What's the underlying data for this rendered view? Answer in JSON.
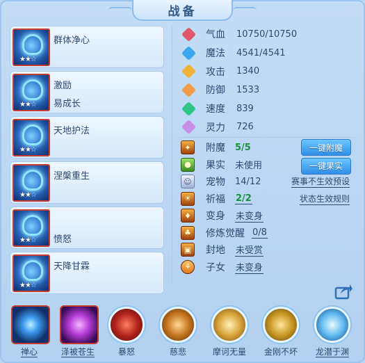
{
  "title": "战备",
  "skills": [
    {
      "name": "群体净心",
      "sub": "",
      "stars_on": 2,
      "stars_total": 3,
      "color": "#3c8ce0"
    },
    {
      "name": "激励",
      "sub": "易成长",
      "stars_on": 2,
      "stars_total": 3,
      "color": "#3c8ce0"
    },
    {
      "name": "天地护法",
      "sub": "",
      "stars_on": 2,
      "stars_total": 3,
      "color": "#2f73c8"
    },
    {
      "name": "涅槃重生",
      "sub": "",
      "stars_on": 2,
      "stars_total": 3,
      "color": "#3c8ce0"
    },
    {
      "name": "",
      "sub": "愤怒",
      "stars_on": 2,
      "stars_total": 3,
      "color": "#3fa0e6"
    },
    {
      "name": "天降甘霖",
      "sub": "",
      "stars_on": 2,
      "stars_total": 3,
      "color": "#3c8ce0"
    }
  ],
  "stats": [
    {
      "label": "气血",
      "value": "10750/10750",
      "icon": "heart-gem-icon",
      "color": "#e0566a"
    },
    {
      "label": "魔法",
      "value": "4541/4541",
      "icon": "mana-gem-icon",
      "color": "#3aa7f0"
    },
    {
      "label": "攻击",
      "value": "1340",
      "icon": "attack-gem-icon",
      "color": "#f2b437"
    },
    {
      "label": "防御",
      "value": "1533",
      "icon": "defense-gem-icon",
      "color": "#f29c4a"
    },
    {
      "label": "速度",
      "value": "839",
      "icon": "speed-gem-icon",
      "color": "#2fc586"
    },
    {
      "label": "灵力",
      "value": "726",
      "icon": "spirit-gem-icon",
      "color": "#c88ee8"
    }
  ],
  "extras": [
    {
      "label": "附魔",
      "value": "5/5",
      "style": "green",
      "icon": "enchant-icon"
    },
    {
      "label": "果实",
      "value": "未使用",
      "style": "plain",
      "icon": "fruit-icon"
    },
    {
      "label": "宠物",
      "value": "14/12",
      "style": "plain",
      "icon": "pet-icon"
    },
    {
      "label": "祈福",
      "value": "2/2",
      "style": "green underline",
      "icon": "blessing-icon"
    },
    {
      "label": "变身",
      "value": "未变身",
      "style": "underline",
      "icon": "transform-icon"
    },
    {
      "label": "修炼觉醒",
      "value": "0/8",
      "style": "underline",
      "icon": "cultivation-icon"
    },
    {
      "label": "封地",
      "value": "未受赏",
      "style": "underline",
      "icon": "fief-icon"
    },
    {
      "label": "子女",
      "value": "未变身",
      "style": "underline",
      "icon": "children-icon"
    }
  ],
  "buttons": {
    "enchant_all": "一键附魔",
    "fruit_all": "一键果实"
  },
  "links": {
    "match_preset": "赛事不生效预设",
    "status_rules": "状态生效规则"
  },
  "bottom_skills": [
    {
      "label": "禅心",
      "underline": true
    },
    {
      "label": "泽被苍生",
      "underline": true
    },
    {
      "label": "暴怒",
      "underline": false
    },
    {
      "label": "慈悲",
      "underline": false
    },
    {
      "label": "摩诃无量",
      "underline": false
    },
    {
      "label": "金刚不坏",
      "underline": false
    },
    {
      "label": "龙潜于渊",
      "underline": true
    }
  ]
}
